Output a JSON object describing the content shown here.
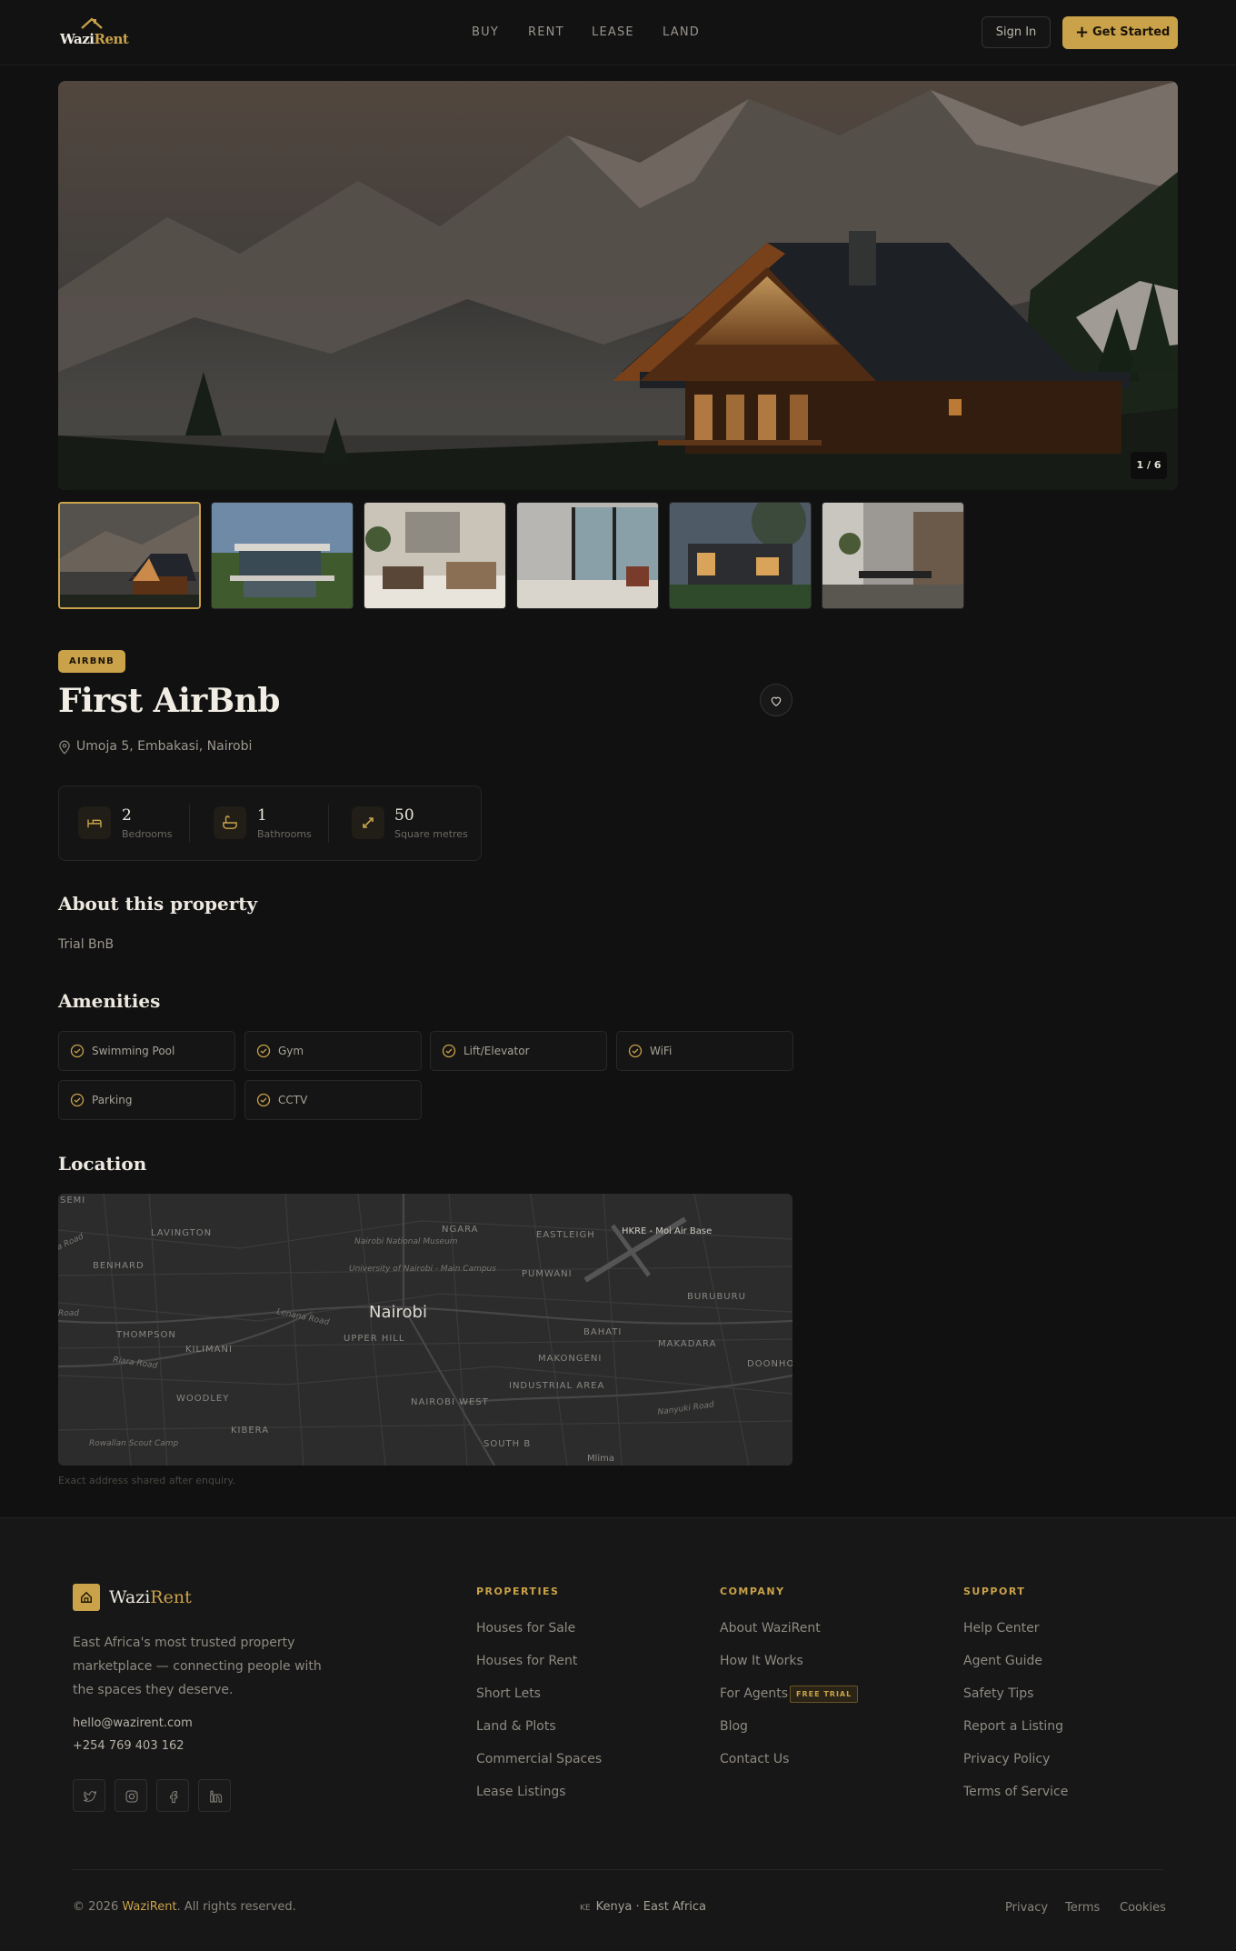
{
  "header": {
    "brand_part1": "Wazi",
    "brand_part2": "Rent",
    "nav": [
      "BUY",
      "RENT",
      "LEASE",
      "LAND"
    ],
    "signin_label": "Sign In",
    "get_started_label": "Get Started"
  },
  "gallery": {
    "counter": "1 / 6",
    "thumbnail_count": 6,
    "active_index": 0
  },
  "listing": {
    "badge": "AIRBNB",
    "title": "First AirBnb",
    "address": "Umoja 5, Embakasi, Nairobi",
    "stats": [
      {
        "icon": "bed-icon",
        "value": "2",
        "label": "Bedrooms"
      },
      {
        "icon": "bath-icon",
        "value": "1",
        "label": "Bathrooms"
      },
      {
        "icon": "expand-icon",
        "value": "50",
        "label": "Square metres"
      }
    ],
    "about_heading": "About this property",
    "about_text": "Trial BnB",
    "amenities_heading": "Amenities",
    "amenities": [
      "Swimming Pool",
      "Gym",
      "Lift/Elevator",
      "WiFi",
      "Parking",
      "CCTV"
    ],
    "location_heading": "Location",
    "map_note": "Exact address shared after enquiry.",
    "map_labels": {
      "city": "Nairobi",
      "areas": [
        "LAVINGTON",
        "BENHARD",
        "NGARA",
        "EASTLEIGH",
        "PUMWANI",
        "BURUBURU",
        "THOMPSON",
        "KILIMANI",
        "UPPER HILL",
        "BAHATI",
        "MAKADARA",
        "MAKONGENI",
        "WOODLEY",
        "KIBERA",
        "NAIROBI WEST",
        "INDUSTRIAL AREA",
        "SOUTH B",
        "DOONHO",
        "SEMI"
      ],
      "places": [
        "Nairobi National Museum",
        "University of Nairobi - Main Campus",
        "HKRE - Moi Air Base",
        "Rowallan Scout Camp",
        "Mlima"
      ],
      "roads": [
        "Lenana Road",
        "Riara Road",
        "Nanyuki Road",
        "a Road",
        "Road"
      ]
    }
  },
  "footer": {
    "brand_part1": "Wazi",
    "brand_part2": "Rent",
    "description": "East Africa's most trusted property marketplace — connecting people with the spaces they deserve.",
    "email": "hello@wazirent.com",
    "phone": "+254 769 403 162",
    "social_icons": [
      "twitter-icon",
      "instagram-icon",
      "facebook-icon",
      "linkedin-icon"
    ],
    "columns": [
      {
        "heading": "PROPERTIES",
        "links": [
          "Houses for Sale",
          "Houses for Rent",
          "Short Lets",
          "Land & Plots",
          "Commercial Spaces",
          "Lease Listings"
        ]
      },
      {
        "heading": "COMPANY",
        "links": [
          "About WaziRent",
          "How It Works",
          "For Agents",
          "Blog",
          "Contact Us"
        ]
      },
      {
        "heading": "SUPPORT",
        "links": [
          "Help Center",
          "Agent Guide",
          "Safety Tips",
          "Report a Listing",
          "Privacy Policy",
          "Terms of Service"
        ]
      }
    ],
    "free_trial_badge": "FREE TRIAL",
    "copyright_pre": "© 2026 ",
    "copyright_brand": "WaziRent",
    "copyright_post": ". All rights reserved.",
    "region_code": "KE",
    "region_text": "Kenya · East Africa",
    "legal_links": [
      "Privacy",
      "Terms",
      "Cookies"
    ]
  },
  "colors": {
    "background": "#111111",
    "accent": "#c9a24a",
    "footer_bg": "#171717"
  }
}
